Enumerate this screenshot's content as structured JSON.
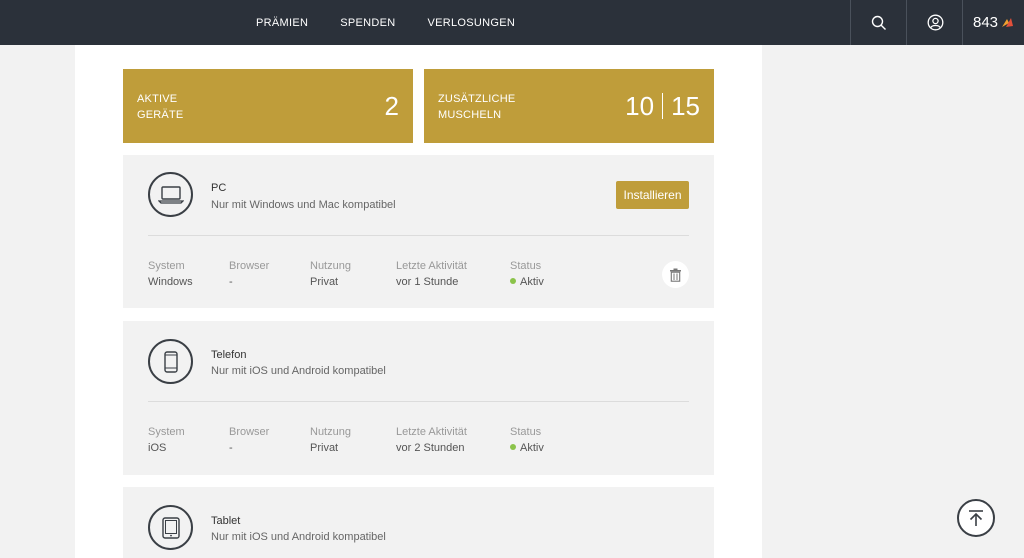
{
  "nav": {
    "items": [
      "PRÄMIEN",
      "SPENDEN",
      "VERLOSUNGEN"
    ]
  },
  "header": {
    "points": "843",
    "icons": [
      "search-icon",
      "user-icon",
      "brand-icon"
    ]
  },
  "stats": {
    "devices_label_1": "AKTIVE",
    "devices_label_2": "GERÄTE",
    "devices_value": "2",
    "extra_label_1": "ZUSÄTZLICHE",
    "extra_label_2": "MUSCHELN",
    "extra_value_a": "10",
    "extra_value_b": "15"
  },
  "columns": {
    "system": "System",
    "browser": "Browser",
    "usage": "Nutzung",
    "last_activity": "Letzte Aktivität",
    "status": "Status"
  },
  "devices": [
    {
      "name": "PC",
      "description": "Nur mit Windows und Mac kompatibel",
      "install_label": "Installieren",
      "system": "Windows",
      "browser": "-",
      "usage": "Privat",
      "last_activity": "vor 1 Stunde",
      "status": "Aktiv"
    },
    {
      "name": "Telefon",
      "description": "Nur mit iOS und Android kompatibel",
      "system": "iOS",
      "browser": "-",
      "usage": "Privat",
      "last_activity": "vor 2 Stunden",
      "status": "Aktiv"
    },
    {
      "name": "Tablet",
      "description": "Nur mit iOS und Android kompatibel"
    }
  ],
  "colors": {
    "topbar": "#2b313a",
    "accent": "#bf9d3a",
    "status_active": "#8bc34a"
  }
}
